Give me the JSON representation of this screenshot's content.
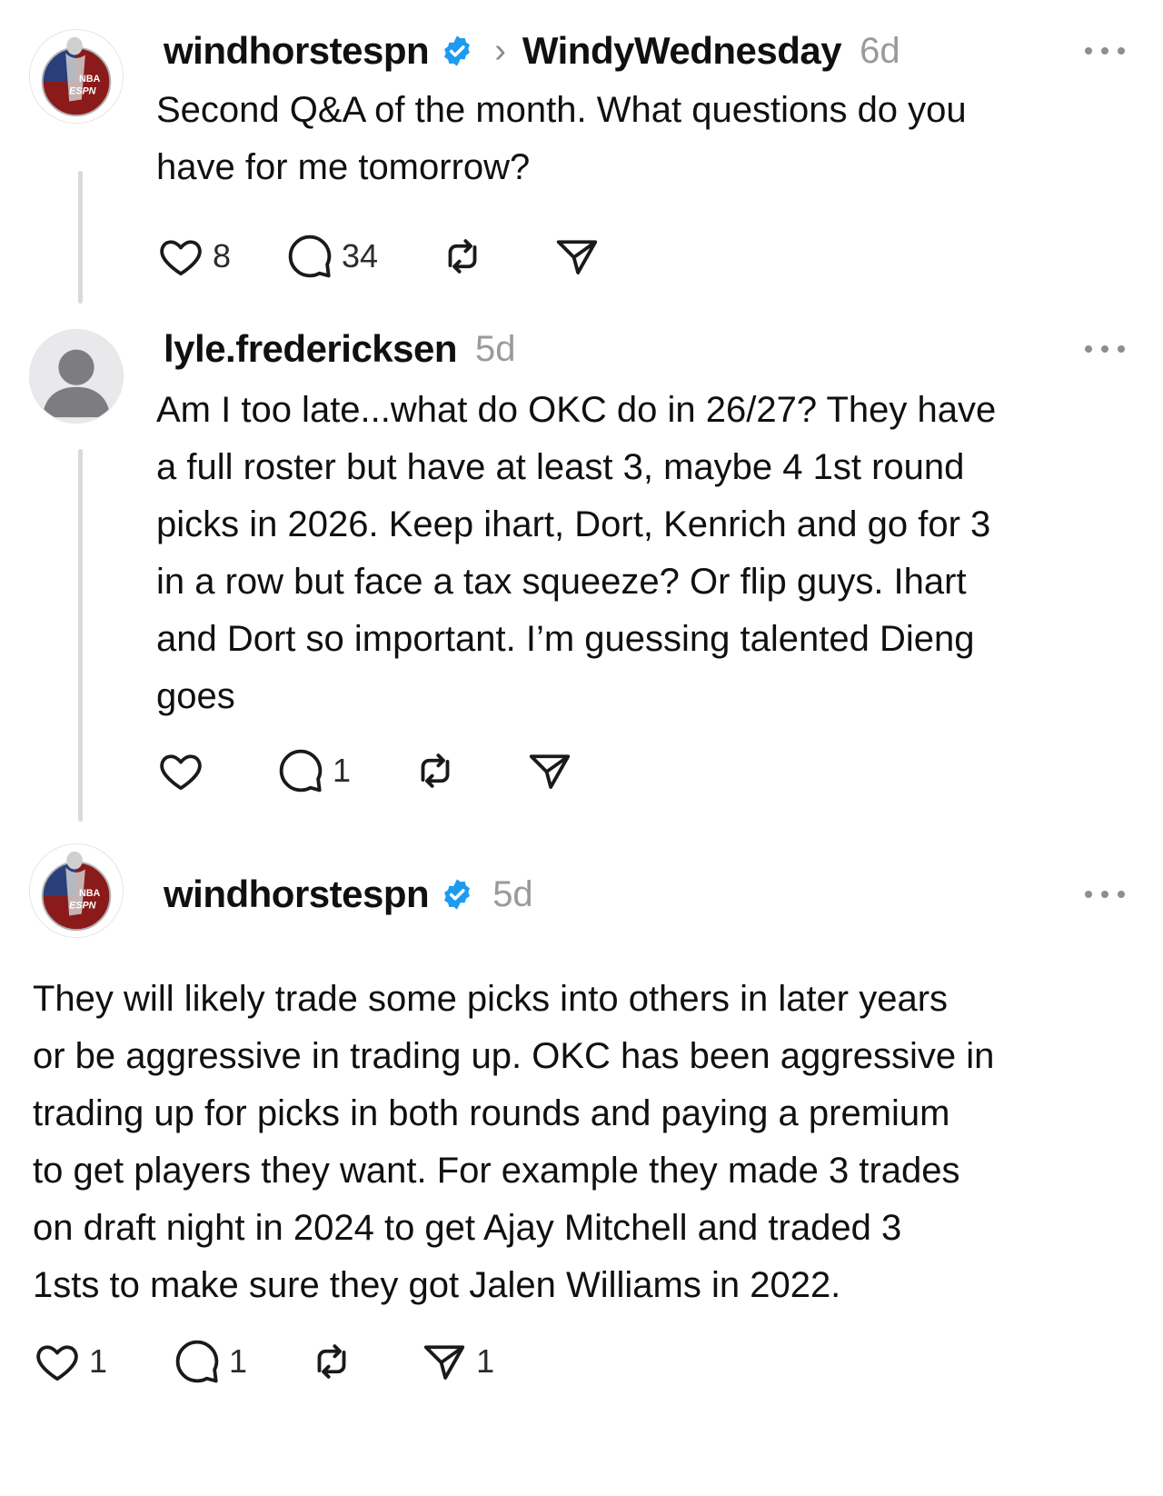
{
  "posts": [
    {
      "username": "windhorstespn",
      "verified": true,
      "community": "WindyWednesday",
      "time": "6d",
      "text": "Second Q&A of the month. What questions do you\nhave for me tomorrow?",
      "likes": "8",
      "replies": "34",
      "reposts": "",
      "shares": "",
      "avatar_icon": "nba-espn-logo-icon"
    },
    {
      "username": "lyle.fredericksen",
      "verified": false,
      "time": "5d",
      "text": "Am I too late...what do OKC do in 26/27? They have\na full roster but have at least 3, maybe 4 1st round\npicks in 2026. Keep ihart, Dort, Kenrich and go for 3\nin a row but face a tax squeeze? Or flip guys. Ihart\nand Dort so important. I’m guessing talented Dieng\ngoes",
      "likes": "",
      "replies": "1",
      "reposts": "",
      "shares": "",
      "avatar_icon": "default-user-icon"
    },
    {
      "username": "windhorstespn",
      "verified": true,
      "time": "5d",
      "text": "They will likely trade some picks into others in later years\nor be aggressive in trading up. OKC has been aggressive in\ntrading up for picks in both rounds and paying a premium\nto get players they want. For example they made 3 trades\non draft night in 2024 to get Ajay Mitchell and traded 3\n1sts to make sure they got Jalen Williams in 2022.",
      "likes": "1",
      "replies": "1",
      "reposts": "",
      "shares": "1",
      "avatar_icon": "nba-espn-logo-icon"
    }
  ],
  "colors": {
    "verified": "#1d9bf0",
    "muted": "#9a9a9a",
    "thread_line": "#d9d9d9",
    "icon_stroke": "#1a1a1a"
  }
}
